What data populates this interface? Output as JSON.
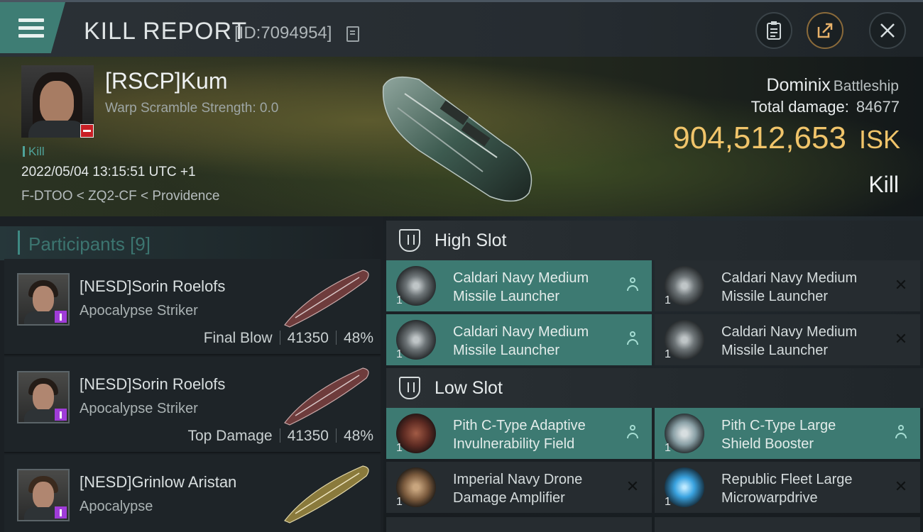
{
  "header": {
    "title": "KILL REPORT",
    "report_id": "[ID:7094954]",
    "buttons": [
      "clipboard-icon",
      "share-icon",
      "close-icon"
    ]
  },
  "victim": {
    "name": "[RSCP]Kum",
    "warp_scramble": "Warp Scramble Strength: 0.0",
    "kill_tag": "Kill",
    "timestamp": "2022/05/04 13:15:51 UTC +1",
    "location": "F-DTOO < ZQ2-CF < Providence",
    "ship_name": "Dominix",
    "ship_class": "Battleship",
    "total_damage_label": "Total damage:",
    "total_damage": "84677",
    "isk_value": "904,512,653",
    "isk_unit": "ISK",
    "result": "Kill"
  },
  "participants": {
    "label": "Participants",
    "count": "[9]",
    "items": [
      {
        "name": "[NESD]Sorin Roelofs",
        "ship": "Apocalypse Striker",
        "role": "Final Blow",
        "damage": "41350",
        "percent": "48%"
      },
      {
        "name": "[NESD]Sorin Roelofs",
        "ship": "Apocalypse Striker",
        "role": "Top Damage",
        "damage": "41350",
        "percent": "48%"
      },
      {
        "name": "[NESD]Grinlow Aristan",
        "ship": "Apocalypse",
        "role": "",
        "damage": "",
        "percent": ""
      }
    ]
  },
  "slots": {
    "high": {
      "label": "High Slot",
      "modules": [
        {
          "line1": "Caldari Navy Medium",
          "line2": "Missile Launcher",
          "qty": "1",
          "status": "dropped"
        },
        {
          "line1": "Caldari Navy Medium",
          "line2": "Missile Launcher",
          "qty": "1",
          "status": "destroyed"
        },
        {
          "line1": "Caldari Navy Medium",
          "line2": "Missile Launcher",
          "qty": "1",
          "status": "dropped"
        },
        {
          "line1": "Caldari Navy Medium",
          "line2": "Missile Launcher",
          "qty": "1",
          "status": "destroyed"
        }
      ]
    },
    "low": {
      "label": "Low Slot",
      "modules": [
        {
          "line1": "Pith C-Type Adaptive",
          "line2": "Invulnerability Field",
          "qty": "1",
          "status": "dropped"
        },
        {
          "line1": "Pith C-Type Large",
          "line2": "Shield Booster",
          "qty": "1",
          "status": "dropped"
        },
        {
          "line1": "Imperial Navy Drone",
          "line2": "Damage Amplifier",
          "qty": "1",
          "status": "destroyed"
        },
        {
          "line1": "Republic Fleet Large",
          "line2": "Microwarpdrive",
          "qty": "1",
          "status": "destroyed"
        }
      ]
    }
  },
  "colors": {
    "accent": "#3d7a72",
    "isk_gold": "#f0c46a",
    "corp_badge": "#c91f25",
    "attacker_badge": "#9f3cd8"
  }
}
